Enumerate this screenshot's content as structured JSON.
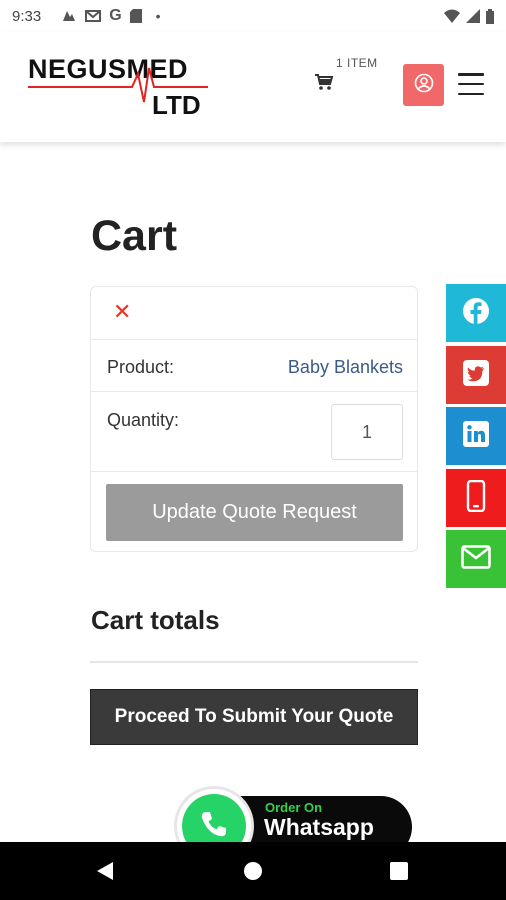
{
  "status_bar": {
    "time": "9:33",
    "dot": "•",
    "icons": [
      "cloud-app-icon",
      "gmail-icon",
      "google-icon",
      "sd-card-icon",
      "wifi-icon",
      "signal-icon",
      "battery-icon"
    ]
  },
  "header": {
    "logo_top": "NEGUSMED",
    "logo_bottom": "LTD",
    "cart_count": "1 ITEM",
    "colors": {
      "account_button": "#f06868",
      "logo_pulse": "#e32222"
    }
  },
  "page": {
    "title": "Cart"
  },
  "cart": {
    "remove_symbol": "✕",
    "product_label": "Product:",
    "product_value": "Baby Blankets",
    "quantity_label": "Quantity:",
    "quantity_value": "1",
    "update_button": "Update Quote Request"
  },
  "totals": {
    "title": "Cart totals",
    "proceed_button": "Proceed To Submit Your Quote"
  },
  "whatsapp": {
    "order_label": "Order On",
    "name": "Whatsapp"
  },
  "social": [
    {
      "icon": "facebook-icon",
      "color": "#1fb8d6"
    },
    {
      "icon": "twitter-icon",
      "color": "#dc3c33"
    },
    {
      "icon": "linkedin-icon",
      "color": "#1d8ed0"
    },
    {
      "icon": "phone-icon",
      "color": "#ee1c1c"
    },
    {
      "icon": "email-icon",
      "color": "#3ac237"
    }
  ]
}
